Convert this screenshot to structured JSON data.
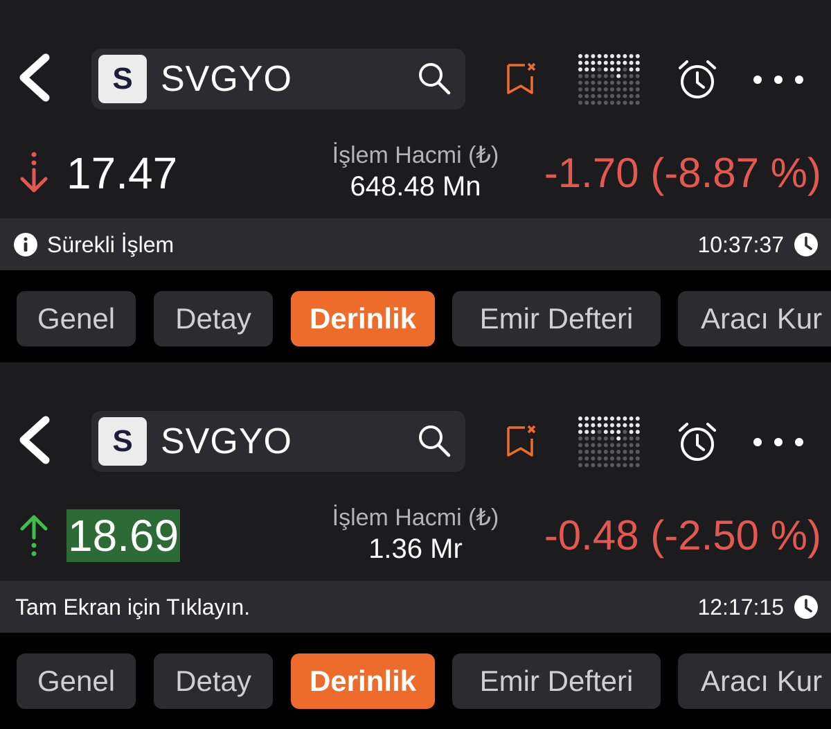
{
  "panels": [
    {
      "symbol_badge": "S",
      "symbol": "SVGYO",
      "direction_icon": "down-arrow-icon",
      "price": "17.47",
      "volume_label": "İşlem Hacmi (₺)",
      "volume_value": "648.48 Mn",
      "change": "-1.70 (-8.87 %)",
      "status_text": "Sürekli İşlem",
      "time": "10:37:37",
      "tabs": [
        "Genel",
        "Detay",
        "Derinlik",
        "Emir Defteri",
        "Aracı Kur"
      ],
      "active_tab": "Derinlik"
    },
    {
      "symbol_badge": "S",
      "symbol": "SVGYO",
      "direction_icon": "up-arrow-icon",
      "price": "18.69",
      "volume_label": "İşlem Hacmi (₺)",
      "volume_value": "1.36 Mr",
      "change": "-0.48 (-2.50 %)",
      "status_text": "Tam Ekran için Tıklayın.",
      "time": "12:17:15",
      "tabs": [
        "Genel",
        "Detay",
        "Derinlik",
        "Emir Defteri",
        "Aracı Kur"
      ],
      "active_tab": "Derinlik"
    }
  ],
  "colors": {
    "background": "#000000",
    "header_bg": "#1c1c1f",
    "bar_bg": "#2c2c30",
    "accent": "#ee6c2b",
    "negative": "#e5584f",
    "positive": "#3fbf4a",
    "price_highlight": "#2c6b35"
  }
}
